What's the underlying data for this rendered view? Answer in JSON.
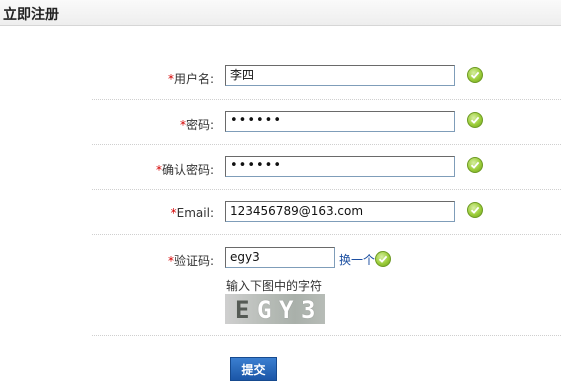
{
  "header": {
    "title": "立即注册"
  },
  "form": {
    "required_mark": "*",
    "username": {
      "label": "用户名:",
      "value": "李四"
    },
    "password": {
      "label": "密码:",
      "value": "••••••"
    },
    "confirm": {
      "label": "确认密码:",
      "value": "••••••"
    },
    "email": {
      "label": "Email:",
      "value": "123456789@163.com"
    },
    "captcha": {
      "label": "验证码:",
      "value": "egy3",
      "refresh_link": "换一个",
      "hint": "输入下图中的字符",
      "image_chars": [
        "E",
        "G",
        "Y",
        "3"
      ]
    },
    "submit_label": "提交"
  },
  "colors": {
    "required": "#d40000",
    "link": "#1a4ea0",
    "valid_icon": "#8cc63f",
    "submit_button": "#1f5bab"
  }
}
